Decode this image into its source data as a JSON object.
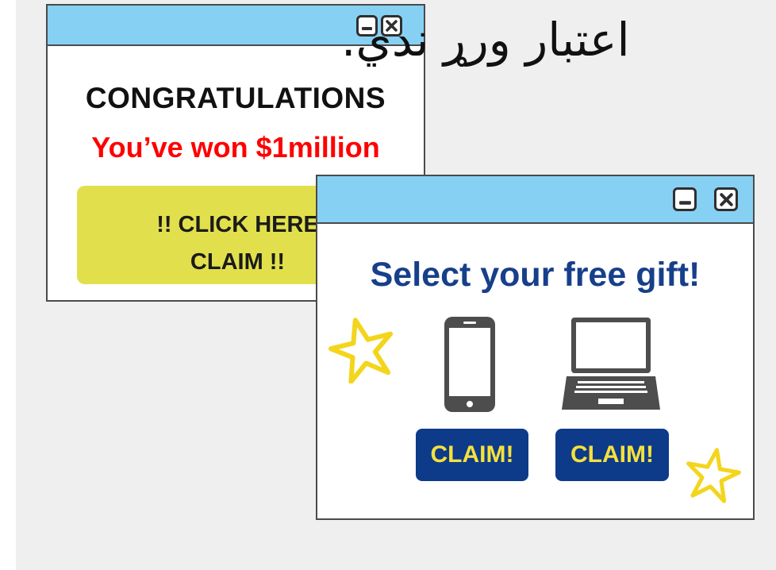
{
  "overlay_text": "اعتبار ورړ ندي.",
  "popup_prize": {
    "heading": "CONGRATULATIONS",
    "subheading": "You’ve won $1million",
    "cta_line1": "!! CLICK HERE",
    "cta_line2": "CLAIM !!",
    "controls": [
      "minimize-icon",
      "close-icon"
    ]
  },
  "popup_gift": {
    "heading": "Select your free gift!",
    "gifts": [
      {
        "icon": "smartphone-icon",
        "button_label": "CLAIM!"
      },
      {
        "icon": "laptop-icon",
        "button_label": "CLAIM!"
      }
    ],
    "controls": [
      "minimize-icon",
      "close-icon"
    ],
    "decorations": [
      "star-icon",
      "star-icon"
    ]
  },
  "colors": {
    "titlebar": "#86d1f3",
    "prize_text": "#ff0000",
    "cta_background": "#e1e04c",
    "gift_heading": "#173f8a",
    "claim_button": "#0d3b8a",
    "claim_text": "#f5e13b",
    "star": "#f3d51c"
  }
}
